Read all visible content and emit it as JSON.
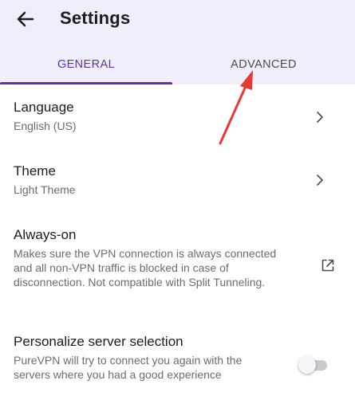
{
  "header": {
    "title": "Settings",
    "back_icon": "arrow-left-icon"
  },
  "tabs": [
    {
      "label": "GENERAL",
      "selected": true
    },
    {
      "label": "ADVANCED",
      "selected": false
    }
  ],
  "settings": [
    {
      "title": "Language",
      "subtitle": "English (US)",
      "trailing": "chevron-right-icon"
    },
    {
      "title": "Theme",
      "subtitle": "Light Theme",
      "trailing": "chevron-right-icon"
    },
    {
      "title": "Always-on",
      "subtitle": "Makes sure the VPN connection is always connected and all non-VPN traffic is blocked in case of disconnection. Not compatible with Split Tunneling.",
      "trailing": "external-link-icon"
    },
    {
      "title": "Personalize server selection",
      "subtitle": "PureVPN will try to connect you again with the servers where you had a good experience",
      "trailing": "toggle-switch",
      "enabled": false
    }
  ],
  "colors": {
    "header_bg": "#f1eefb",
    "accent": "#5b34a6",
    "annotation": "#e53935"
  }
}
